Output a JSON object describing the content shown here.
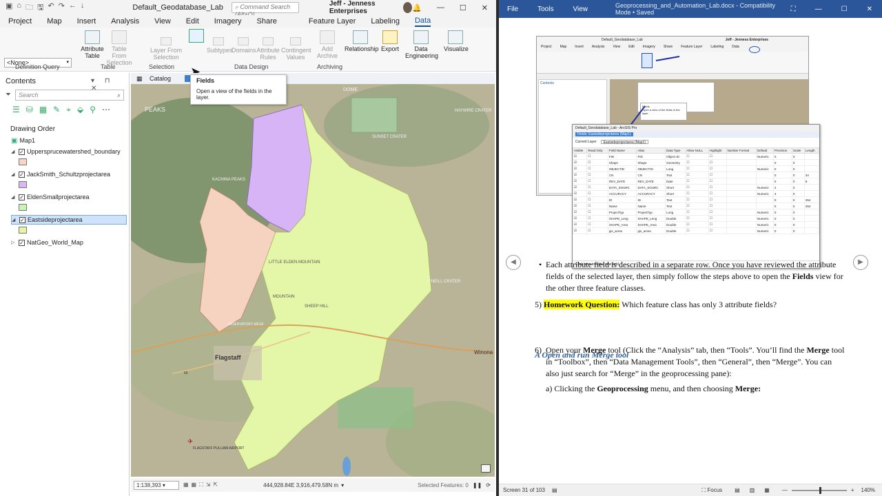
{
  "arcgis": {
    "quick_access": [
      "▣",
      "⌂",
      "🗀",
      "🖫",
      "↶",
      "↷",
      "←",
      "↓"
    ],
    "project_name": "Default_Geodatabase_Lab",
    "command_search_placeholder": "Command Search (Alt+Q)",
    "user_name": "Jeff - Jenness Enterprises",
    "tabs": [
      "Project",
      "Map",
      "Insert",
      "Analysis",
      "View",
      "Edit",
      "Imagery",
      "Share",
      "Feature Layer",
      "Labeling",
      "Data"
    ],
    "definition_query_value": "<None>",
    "ribbon_buttons": {
      "attribute_table": "Attribute Table",
      "table_from_selection": "Table From Selection",
      "layer_from_selection": "Layer From Selection",
      "fields": "",
      "subtypes": "Subtypes",
      "domains": "Domains",
      "attribute_rules": "Attribute Rules",
      "contingent_values": "Contingent Values",
      "add_archive": "Add Archive",
      "relationship": "Relationship",
      "export": "Export",
      "data_engineering": "Data Engineering",
      "visualize": "Visualize"
    },
    "ribbon_groups": {
      "definition_query": "Definition Query",
      "table": "Table",
      "selection": "Selection",
      "data_design": "Data Design",
      "archiving": "Archiving"
    },
    "tooltip": {
      "title": "Fields",
      "text": "Open a view of the fields in the layer."
    },
    "contents": {
      "title": "Contents",
      "search_placeholder": "Search",
      "drawing_order": "Drawing Order",
      "map_name": "Map1",
      "layers": [
        {
          "name": "Uppersprucewatershed_boundary",
          "color": "#f6d7c4"
        },
        {
          "name": "JackSmith_Schultzprojectarea",
          "color": "#d9b8f3"
        },
        {
          "name": "EldenSmallprojectarea",
          "color": "#c8f5b0"
        },
        {
          "name": "Eastsideprojectarea",
          "color": "#e4f6a8"
        },
        {
          "name": "NatGeo_World_Map",
          "color": ""
        }
      ]
    },
    "map_tabs": {
      "catalog": "Catalog",
      "map": "M"
    },
    "map_labels": {
      "peaks": "PEAKS",
      "haywire": "HAYWIRE CRATER",
      "sunset": "SUNSET CRATER",
      "kachina": "KACHINA PEAKS",
      "little_elden": "LITTLE ELDEN MOUNTAIN",
      "oneill": "O'NEILL CRATER",
      "sheep_hill": "SHEEP HILL",
      "flagstaff": "Flagstaff",
      "winona": "Winona",
      "airport": "FLAGSTAFF PULLIAM AIRPORT",
      "observatory": "OBSERVATORY MESA",
      "dome": "DOME",
      "mountain": "MOUNTAIN",
      "route": "66"
    },
    "scale": "1:138,393",
    "coordinates": "444,928.84E 3,916,479.58N m",
    "selected_features": "Selected Features: 0"
  },
  "word": {
    "menu": [
      "File",
      "Tools",
      "View"
    ],
    "doc_title": "Geoprocessing_and_Automation_Lab.docx - Compatibility Mode • Saved",
    "bullet_text_a": "Each attribute field is described in a separate row.  Once you have reviewed the attribute fields of the selected layer, then simply follow the steps above to open the ",
    "bullet_text_bold": "Fields",
    "bullet_text_b": " view for the other three feature classes.",
    "q5_num": "5)",
    "q5_label": "Homework Question:",
    "q5_text": "Which feature class has only 3 attribute fields?",
    "section_heading": "A Open and run Merge tool",
    "s6_num": "6)",
    "s6_a": "Open your ",
    "s6_b": "Merge",
    "s6_c": " tool (Click the “Analysis” tab, then “Tools”.  You’ll find the ",
    "s6_d": "Merge",
    "s6_e": " tool in “Toolbox”, then “Data Management Tools”, then “General”, then “Merge”.  You can also just search for “Merge” in the geoprocessing pane):",
    "s6a_a": "a) Clicking the ",
    "s6a_b": "Geoprocessing",
    "s6a_c": " menu, and then choosing ",
    "s6a_d": "Merge:",
    "status_screen": "Screen 31 of 103",
    "status_focus": "Focus",
    "status_zoom": "140%",
    "embedded": {
      "project_name": "Default_Geodatabase_Lab",
      "user": "Jeff - Jenness Enterprises",
      "tabs": [
        "Project",
        "Map",
        "Insert",
        "Analysis",
        "View",
        "Edit",
        "Imagery",
        "Share",
        "Feature Layer",
        "Labeling",
        "Data"
      ],
      "fields_window_title": "Default_Geodatabase_Lab - ArcGIS Pro",
      "fields_tab": "Fields: Eastsideprojectarea (Map1)",
      "current_layer_label": "Current Layer",
      "current_layer_value": "Eastsideprojectarea (Map1)",
      "columns": [
        "Visible",
        "Read Only",
        "Field Name",
        "Alias",
        "Data Type",
        "Allow NULL",
        "Highlight",
        "Number Format",
        "Default",
        "Precision",
        "Scale",
        "Length"
      ],
      "rows": [
        [
          "FID",
          "FID",
          "Object ID",
          "",
          "Numeric",
          "0",
          "0",
          ""
        ],
        [
          "Shape",
          "Shape",
          "Geometry",
          "",
          "",
          "0",
          "0",
          ""
        ],
        [
          "OBJECTID",
          "OBJECTID",
          "Long",
          "",
          "Numeric",
          "0",
          "0",
          ""
        ],
        [
          "CN",
          "CN",
          "Text",
          "",
          "",
          "0",
          "0",
          "34"
        ],
        [
          "REV_DATE",
          "REV_DATE",
          "Date",
          "",
          "",
          "0",
          "0",
          "8"
        ],
        [
          "DATA_SOURC",
          "DATA_SOURC",
          "Short",
          "",
          "Numeric",
          "4",
          "0",
          ""
        ],
        [
          "ACCURACY",
          "ACCURACY",
          "Short",
          "",
          "Numeric",
          "4",
          "0",
          ""
        ],
        [
          "ID",
          "ID",
          "Text",
          "",
          "",
          "0",
          "0",
          "254"
        ],
        [
          "Name",
          "Name",
          "Text",
          "",
          "",
          "0",
          "0",
          "254"
        ],
        [
          "ProjectTyp",
          "ProjectTyp",
          "Long",
          "",
          "Numeric",
          "0",
          "0",
          ""
        ],
        [
          "SHAPE_Leng",
          "SHAPE_Leng",
          "Double",
          "",
          "Numeric",
          "0",
          "0",
          ""
        ],
        [
          "SHAPE_Area",
          "SHAPE_Area",
          "Double",
          "",
          "Numeric",
          "0",
          "0",
          ""
        ],
        [
          "gis_acres",
          "gis_acres",
          "Double",
          "",
          "Numeric",
          "0",
          "0",
          ""
        ]
      ],
      "add_field_hint": "Click here to add a new field."
    }
  }
}
